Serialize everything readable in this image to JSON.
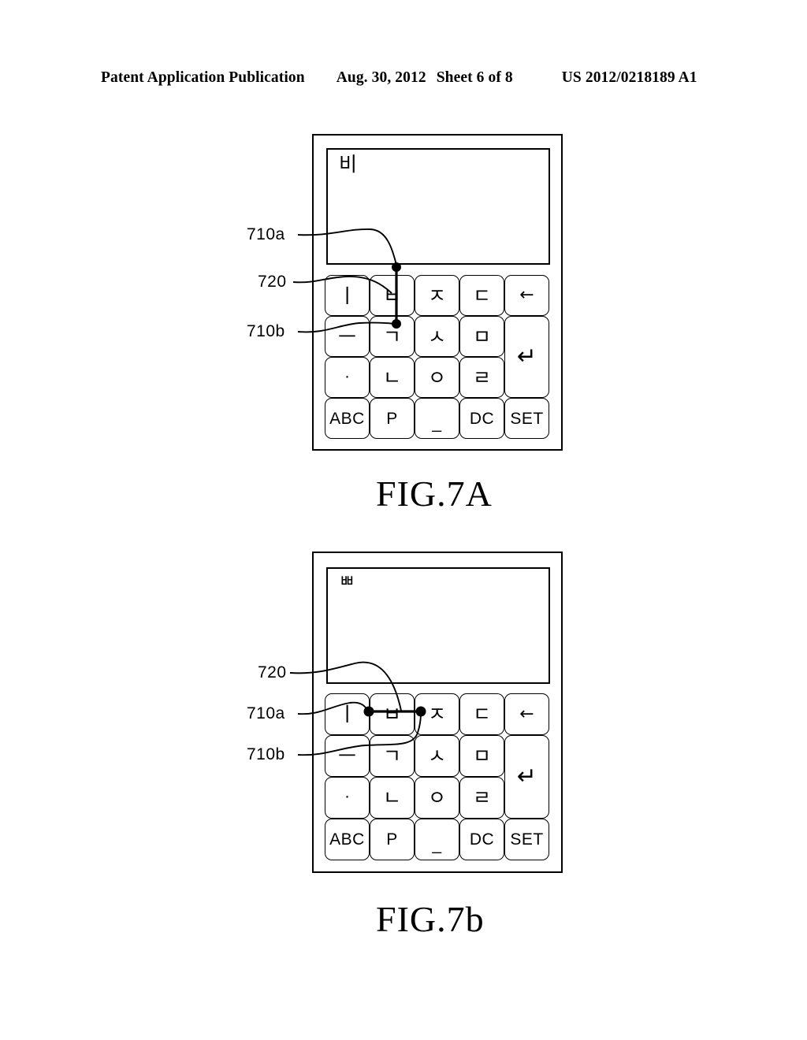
{
  "header": {
    "publication": "Patent Application Publication",
    "date": "Aug. 30, 2012",
    "sheet": "Sheet 6 of 8",
    "number": "US 2012/0218189 A1"
  },
  "figures": [
    {
      "id": "7a",
      "caption": "FIG.7A",
      "display_text": "비",
      "gesture": {
        "type": "vertical-drag",
        "description": "drag downward from key 'ㅂ' to key 'ㄱ'"
      },
      "labels": [
        {
          "id": "710a",
          "text": "710a"
        },
        {
          "id": "720",
          "text": "720"
        },
        {
          "id": "710b",
          "text": "710b"
        }
      ],
      "keys": [
        {
          "label": "ㅣ",
          "kind": "hangul"
        },
        {
          "label": "ㅂ",
          "kind": "hangul"
        },
        {
          "label": "ㅈ",
          "kind": "hangul"
        },
        {
          "label": "ㄷ",
          "kind": "hangul"
        },
        {
          "label": "←",
          "kind": "icon",
          "name": "backspace"
        },
        {
          "label": "ㅡ",
          "kind": "hangul"
        },
        {
          "label": "ㄱ",
          "kind": "hangul"
        },
        {
          "label": "ㅅ",
          "kind": "hangul"
        },
        {
          "label": "ㅁ",
          "kind": "hangul"
        },
        {
          "label": "↵",
          "kind": "icon",
          "name": "enter"
        },
        {
          "label": "·",
          "kind": "hangul"
        },
        {
          "label": "ㄴ",
          "kind": "hangul"
        },
        {
          "label": "ㅇ",
          "kind": "hangul"
        },
        {
          "label": "ㄹ",
          "kind": "hangul"
        },
        {
          "label": "ABC",
          "kind": "latin"
        },
        {
          "label": "P",
          "kind": "latin"
        },
        {
          "label": "_",
          "kind": "latin"
        },
        {
          "label": "DC",
          "kind": "latin"
        },
        {
          "label": "SET",
          "kind": "latin"
        }
      ]
    },
    {
      "id": "7b",
      "caption": "FIG.7b",
      "display_text": "ㅃ",
      "gesture": {
        "type": "horizontal-drag",
        "description": "drag rightward from key 'ㅣ' across key 'ㅂ' to key 'ㅈ'"
      },
      "labels": [
        {
          "id": "720",
          "text": "720"
        },
        {
          "id": "710a",
          "text": "710a"
        },
        {
          "id": "710b",
          "text": "710b"
        }
      ],
      "keys": [
        {
          "label": "ㅣ",
          "kind": "hangul"
        },
        {
          "label": "ㅂ",
          "kind": "hangul"
        },
        {
          "label": "ㅈ",
          "kind": "hangul"
        },
        {
          "label": "ㄷ",
          "kind": "hangul"
        },
        {
          "label": "←",
          "kind": "icon",
          "name": "backspace"
        },
        {
          "label": "ㅡ",
          "kind": "hangul"
        },
        {
          "label": "ㄱ",
          "kind": "hangul"
        },
        {
          "label": "ㅅ",
          "kind": "hangul"
        },
        {
          "label": "ㅁ",
          "kind": "hangul"
        },
        {
          "label": "↵",
          "kind": "icon",
          "name": "enter"
        },
        {
          "label": "·",
          "kind": "hangul"
        },
        {
          "label": "ㄴ",
          "kind": "hangul"
        },
        {
          "label": "ㅇ",
          "kind": "hangul"
        },
        {
          "label": "ㄹ",
          "kind": "hangul"
        },
        {
          "label": "ABC",
          "kind": "latin"
        },
        {
          "label": "P",
          "kind": "latin"
        },
        {
          "label": "_",
          "kind": "latin"
        },
        {
          "label": "DC",
          "kind": "latin"
        },
        {
          "label": "SET",
          "kind": "latin"
        }
      ]
    }
  ]
}
